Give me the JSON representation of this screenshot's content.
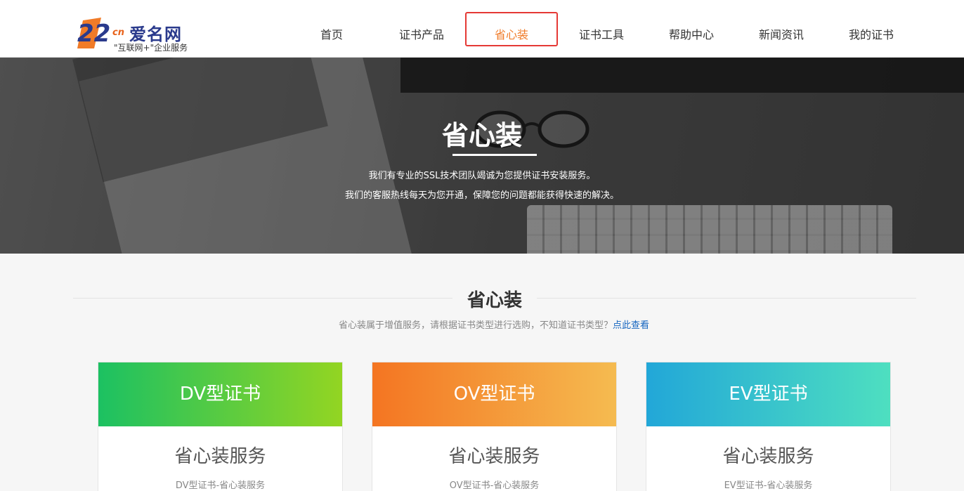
{
  "header": {
    "logo": {
      "number": "22",
      "cn": "cn",
      "brand": "爱名网",
      "slogan": "\"互联网+\"企业服务"
    },
    "nav": [
      {
        "label": "首页",
        "active": false
      },
      {
        "label": "证书产品",
        "active": false
      },
      {
        "label": "省心装",
        "active": true
      },
      {
        "label": "证书工具",
        "active": false
      },
      {
        "label": "帮助中心",
        "active": false
      },
      {
        "label": "新闻资讯",
        "active": false
      },
      {
        "label": "我的证书",
        "active": false
      }
    ],
    "active_color": "#f07b28"
  },
  "banner": {
    "title": "省心装",
    "line1": "我们有专业的SSL技术团队竭诚为您提供证书安装服务。",
    "line2": "我们的客服热线每天为您开通，保障您的问题都能获得快速的解决。"
  },
  "section": {
    "title": "省心装",
    "desc": "省心装属于增值服务，请根据证书类型进行选购，不知道证书类型？",
    "link": "点此查看"
  },
  "cards": [
    {
      "title": "DV型证书",
      "service": "省心装服务",
      "sub": "DV型证书-省心装服务"
    },
    {
      "title": "OV型证书",
      "service": "省心装服务",
      "sub": "OV型证书-省心装服务"
    },
    {
      "title": "EV型证书",
      "service": "省心装服务",
      "sub": "EV型证书-省心装服务"
    }
  ]
}
